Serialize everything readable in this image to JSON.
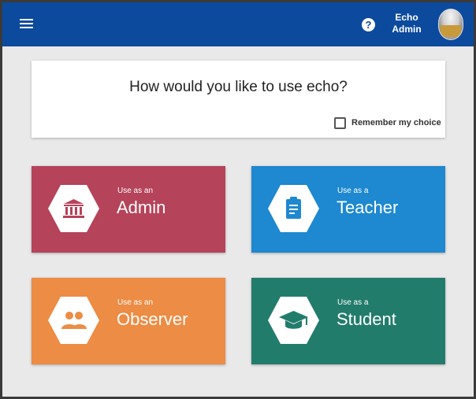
{
  "header": {
    "user_first": "Echo",
    "user_last": "Admin",
    "help_glyph": "?",
    "icons": [
      "menu-icon",
      "help-icon",
      "avatar"
    ]
  },
  "question": {
    "title": "How would you like to use echo?",
    "remember_label": "Remember my choice",
    "remember_checked": false
  },
  "roles": [
    {
      "pre": "Use as an",
      "name": "Admin",
      "color": "#b5435a",
      "icon": "institution-icon",
      "icon_color": "#b5435a"
    },
    {
      "pre": "Use as a",
      "name": "Teacher",
      "color": "#1e88d0",
      "icon": "clipboard-icon",
      "icon_color": "#1e88d0"
    },
    {
      "pre": "Use as an",
      "name": "Observer",
      "color": "#ec8c45",
      "icon": "people-icon",
      "icon_color": "#ec8c45"
    },
    {
      "pre": "Use as a",
      "name": "Student",
      "color": "#227c6c",
      "icon": "graduation-cap-icon",
      "icon_color": "#227c6c"
    }
  ],
  "colors": {
    "topbar": "#0c4a9e",
    "background": "#e9e9e9"
  }
}
